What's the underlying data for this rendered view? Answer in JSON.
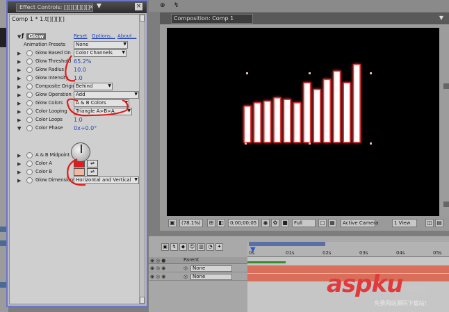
{
  "effect_controls": {
    "title": "Effect Controls: [][][][][][]",
    "title_menu": "▼",
    "title_time_sep": "x",
    "close_glyph": "×",
    "comp_name": "Comp 1 * 1.t[][][][]",
    "effect": {
      "name": "Glow",
      "reset": "Reset",
      "options": "Options...",
      "about": "About..."
    },
    "properties": [
      {
        "label": "Animation Presets",
        "kind": "dropdown",
        "value": "None"
      },
      {
        "label": "Glow Based On",
        "kind": "dropdown",
        "value": "Color Channels"
      },
      {
        "label": "Glow Threshold",
        "kind": "value",
        "value": "65.2%"
      },
      {
        "label": "Glow Radius",
        "kind": "value",
        "value": "10.0"
      },
      {
        "label": "Glow Intensity",
        "kind": "value",
        "value": "1.0"
      },
      {
        "label": "Composite Original",
        "kind": "dropdown",
        "value": "Behind"
      },
      {
        "label": "Glow Operation",
        "kind": "dropdown",
        "value": "Add"
      },
      {
        "label": "Glow Colors",
        "kind": "dropdown",
        "value": "A & B Colors"
      },
      {
        "label": "Color Looping",
        "kind": "dropdown",
        "value": "Triangle A>B>A"
      },
      {
        "label": "Color Loops",
        "kind": "value",
        "value": "1.0"
      },
      {
        "label": "Color Phase",
        "kind": "value",
        "value": "0x+0.0°"
      },
      {
        "label": "A & B Midpoint",
        "kind": "value",
        "value": "50%"
      },
      {
        "label": "Color A",
        "kind": "color",
        "value": "#e11b1b"
      },
      {
        "label": "Color B",
        "kind": "color",
        "value": "#f3b9a0"
      },
      {
        "label": "Glow Dimensions",
        "kind": "dropdown",
        "value": "Horizontal and Vertical"
      }
    ]
  },
  "top_toolbar": {
    "t1": "⊕",
    "t2": "↯"
  },
  "composition": {
    "tab_label": "Composition: Comp 1",
    "tab_menu": "▼",
    "zoom": "(78.1%)",
    "timecode": "0;00;00;05",
    "resolution": "Full",
    "camera": "Active Camera",
    "view": "1 View",
    "bars": [
      0.42,
      0.46,
      0.48,
      0.52,
      0.5,
      0.46,
      0.7,
      0.62,
      0.74,
      0.84,
      0.7,
      0.92
    ],
    "bar_color": "#e23a3a"
  },
  "timeline": {
    "parent_header": "Parent",
    "layers": [
      {
        "parent": "None"
      },
      {
        "parent": "None"
      }
    ],
    "ruler_ticks": [
      "0s",
      "01s",
      "02s",
      "03s",
      "04s",
      "05s"
    ],
    "cti_glyph": "▼",
    "work_area_color": "#5b6fa6"
  },
  "watermark": {
    "main": "aspku",
    "suffix": ".com",
    "sub": "免费网站源码下载站!"
  }
}
